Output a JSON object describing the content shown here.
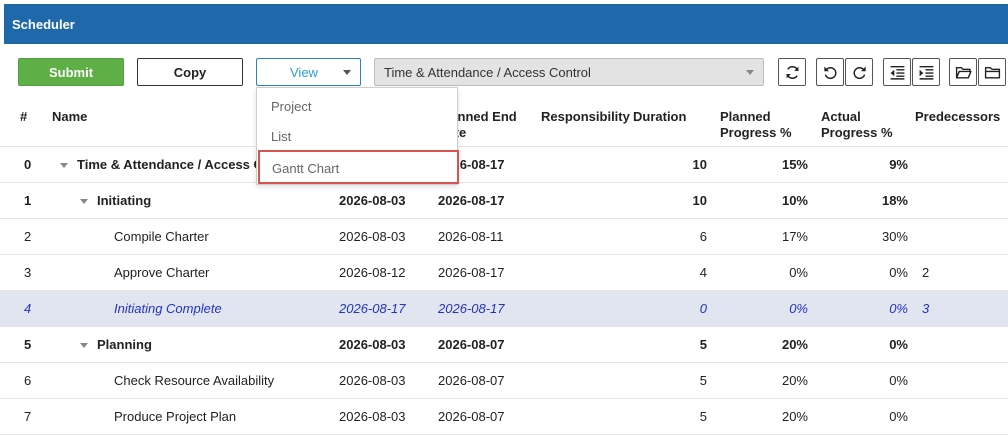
{
  "window": {
    "title": "Scheduler"
  },
  "toolbar": {
    "submit_label": "Submit",
    "copy_label": "Copy",
    "view_label": "View",
    "project_selected": "Time & Attendance / Access Control"
  },
  "view_menu": {
    "items": [
      "Project",
      "List",
      "Gantt Chart"
    ],
    "highlighted": "Gantt Chart"
  },
  "icons": [
    "refresh-icon",
    "undo-icon",
    "redo-icon",
    "outdent-icon",
    "indent-icon",
    "folder-open-icon",
    "folder-icon"
  ],
  "colors": {
    "titlebar": "#1f69ab",
    "submit": "#5daf46",
    "view_accent": "#2a9fd8",
    "selected_row_bg": "#e1e5f0",
    "selected_row_text": "#2333c4",
    "highlight_border": "#d9534f"
  },
  "table": {
    "headers": {
      "num": "#",
      "name": "Name",
      "planned_start": "",
      "planned_end": "Planned End Date",
      "responsibility": "Responsibility",
      "duration": "Duration",
      "planned_progress": "Planned Progress %",
      "actual_progress": "Actual Progress %",
      "predecessors": "Predecessors"
    },
    "rows": [
      {
        "num": "0",
        "name": "Time & Attendance / Access Control",
        "start": "",
        "end": "2026-08-17",
        "responsibility": "",
        "duration": "10",
        "planned": "15%",
        "actual": "9%",
        "pred": ""
      },
      {
        "num": "1",
        "name": "Initiating",
        "start": "2026-08-03",
        "end": "2026-08-17",
        "responsibility": "",
        "duration": "10",
        "planned": "10%",
        "actual": "18%",
        "pred": ""
      },
      {
        "num": "2",
        "name": "Compile Charter",
        "start": "2026-08-03",
        "end": "2026-08-11",
        "responsibility": "",
        "duration": "6",
        "planned": "17%",
        "actual": "30%",
        "pred": ""
      },
      {
        "num": "3",
        "name": "Approve Charter",
        "start": "2026-08-12",
        "end": "2026-08-17",
        "responsibility": "",
        "duration": "4",
        "planned": "0%",
        "actual": "0%",
        "pred": "2"
      },
      {
        "num": "4",
        "name": "Initiating Complete",
        "start": "2026-08-17",
        "end": "2026-08-17",
        "responsibility": "",
        "duration": "0",
        "planned": "0%",
        "actual": "0%",
        "pred": "3"
      },
      {
        "num": "5",
        "name": "Planning",
        "start": "2026-08-03",
        "end": "2026-08-07",
        "responsibility": "",
        "duration": "5",
        "planned": "20%",
        "actual": "0%",
        "pred": ""
      },
      {
        "num": "6",
        "name": "Check Resource Availability",
        "start": "2026-08-03",
        "end": "2026-08-07",
        "responsibility": "",
        "duration": "5",
        "planned": "20%",
        "actual": "0%",
        "pred": ""
      },
      {
        "num": "7",
        "name": "Produce Project Plan",
        "start": "2026-08-03",
        "end": "2026-08-07",
        "responsibility": "",
        "duration": "5",
        "planned": "20%",
        "actual": "0%",
        "pred": ""
      }
    ]
  }
}
